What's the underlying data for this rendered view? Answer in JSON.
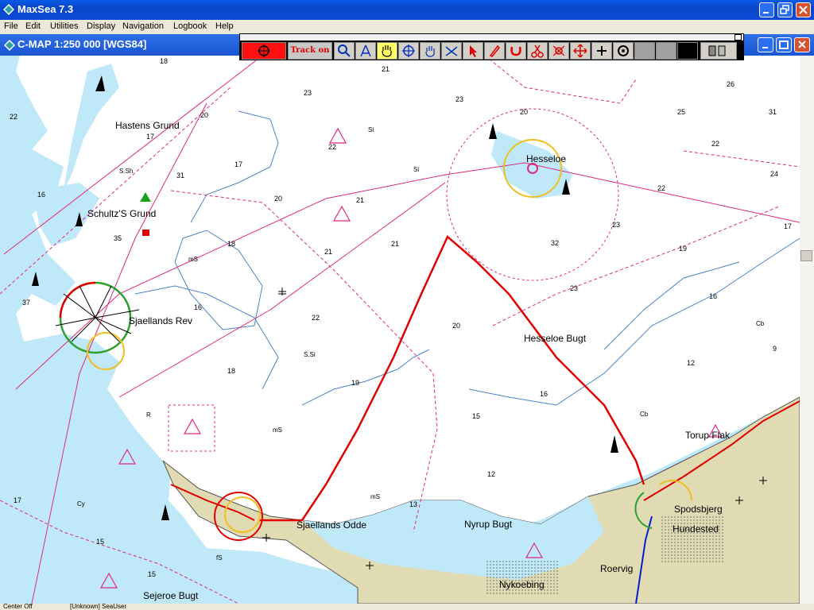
{
  "app": {
    "title": "MaxSea 7.3"
  },
  "menu": {
    "items": [
      "File",
      "Edit",
      "Utilities",
      "Display",
      "Navigation",
      "Logbook",
      "Help"
    ]
  },
  "chart_window": {
    "title": "C-MAP  1:250 000 [WGS84]"
  },
  "toolbar": {
    "track_label": "Track on",
    "icons": [
      "zoom-icon",
      "compass-icon",
      "hand-pan-icon",
      "center-crosshair-icon",
      "grab-icon",
      "route-icon",
      "pointer-icon",
      "pencil-icon",
      "magnet-icon",
      "scissors-icon",
      "waypoint-icon",
      "move-icon",
      "plus-cross-icon",
      "target-icon"
    ]
  },
  "map": {
    "places": {
      "hastens_grund": "Hastens Grund",
      "schultz_grund": "Schultz'S Grund",
      "sjaellands_rev": "Sjaellands Rev",
      "hesseloe": "Hesseloe",
      "hesseloe_bugt": "Hesseloe Bugt",
      "torup_flak": "Torup Flak",
      "spodsbjerg": "Spodsbjerg",
      "hundested": "Hundested",
      "sjaellands_odde": "Sjaellands Odde",
      "nyrup_bugt": "Nyrup Bugt",
      "roervig": "Roervig",
      "nykoebing": "Nykoebing",
      "sejeroe_bugt": "Sejeroe Bugt"
    },
    "seabed": [
      "S.Sh",
      "mS",
      "S.Si",
      "Si",
      "Cb",
      "Cy",
      "fS",
      "R"
    ],
    "depths": [
      "18",
      "22",
      "20",
      "17",
      "31",
      "17",
      "16",
      "35",
      "37",
      "23",
      "22",
      "21",
      "20",
      "21",
      "21",
      "23",
      "20",
      "23",
      "26",
      "25",
      "31",
      "22",
      "24",
      "22",
      "32",
      "23",
      "17",
      "18",
      "19",
      "16",
      "18",
      "22",
      "21",
      "20",
      "16",
      "19",
      "16",
      "15",
      "12",
      "12",
      "15",
      "13",
      "15",
      "17",
      "9"
    ]
  },
  "status": {
    "left": "Center Off",
    "middle": "[Unknown] SeaUser"
  },
  "colors": {
    "water_shallow": "#bfe8f8",
    "land": "#e0dbb3",
    "route": "#e00000",
    "chart_lines": "#e0287f"
  }
}
